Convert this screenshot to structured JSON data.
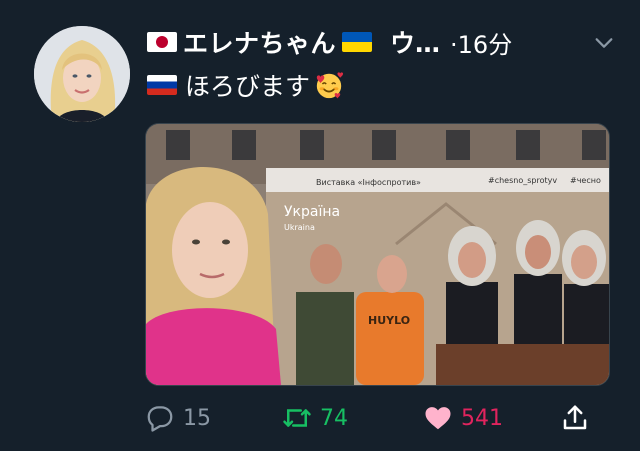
{
  "author": {
    "display_name": "エレナちゃん",
    "handle": "ウ…",
    "timestamp": "·16分",
    "name_flags": [
      "japan-flag",
      "ukraine-flag"
    ]
  },
  "tweet": {
    "text": "ほろびます",
    "text_flag": "russia-flag",
    "emoji": "smiling-face-with-hearts"
  },
  "media": {
    "banner_hashtags": "#chesno_sprotyv",
    "banner_hashtag_2": "#чесно",
    "banner_title": "Виставка «Інфоспротив»",
    "country_label": "Україна",
    "country_label_small": "Ukraina",
    "shirt_text": "HUYLO"
  },
  "actions": {
    "reply_count": "15",
    "retweet_count": "74",
    "like_count": "541"
  },
  "colors": {
    "background": "#15202b",
    "retweet": "#17bf63",
    "like": "#e0245e",
    "muted": "#8b98a5"
  }
}
